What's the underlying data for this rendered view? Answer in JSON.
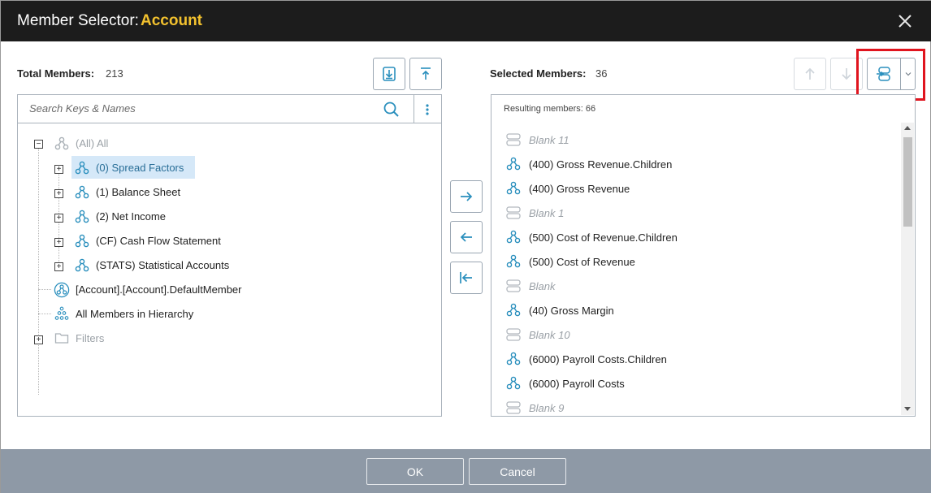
{
  "dialog": {
    "title_label": "Member Selector:",
    "title_value": "Account",
    "accent_color": "#f2c12e",
    "highlight_color": "#e0141e"
  },
  "left_panel": {
    "label": "Total Members:",
    "count": "213",
    "search_placeholder": "Search Keys & Names",
    "tree": [
      {
        "label": "(All) All",
        "icon": "hierarchy-icon",
        "muted": true,
        "expander": "−"
      },
      {
        "label": "(0) Spread Factors",
        "icon": "hierarchy-icon",
        "selected": true,
        "expander": "+"
      },
      {
        "label": "(1) Balance Sheet",
        "icon": "hierarchy-icon",
        "expander": "+"
      },
      {
        "label": "(2) Net Income",
        "icon": "hierarchy-icon",
        "expander": "+"
      },
      {
        "label": "(CF) Cash Flow Statement",
        "icon": "hierarchy-icon",
        "expander": "+"
      },
      {
        "label": "(STATS) Statistical Accounts",
        "icon": "hierarchy-icon",
        "expander": "+"
      },
      {
        "label": "[Account].[Account].DefaultMember",
        "icon": "default-member-icon"
      },
      {
        "label": "All Members in Hierarchy",
        "icon": "all-members-icon"
      },
      {
        "label": "Filters",
        "icon": "folder-icon",
        "muted": true,
        "expander": "+"
      }
    ]
  },
  "right_panel": {
    "label": "Selected Members:",
    "count": "36",
    "result_caption": "Resulting members: 66",
    "items": [
      {
        "label": "Blank 11",
        "type": "blank"
      },
      {
        "label": "(400) Gross Revenue.Children",
        "type": "member"
      },
      {
        "label": "(400) Gross Revenue",
        "type": "member"
      },
      {
        "label": "Blank 1",
        "type": "blank"
      },
      {
        "label": "(500) Cost of Revenue.Children",
        "type": "member"
      },
      {
        "label": "(500) Cost of Revenue",
        "type": "member"
      },
      {
        "label": "Blank",
        "type": "blank"
      },
      {
        "label": "(40) Gross Margin",
        "type": "member"
      },
      {
        "label": "Blank 10",
        "type": "blank"
      },
      {
        "label": "(6000) Payroll Costs.Children",
        "type": "member"
      },
      {
        "label": "(6000) Payroll Costs",
        "type": "member"
      },
      {
        "label": "Blank 9",
        "type": "blank"
      }
    ]
  },
  "footer": {
    "ok_label": "OK",
    "cancel_label": "Cancel"
  }
}
